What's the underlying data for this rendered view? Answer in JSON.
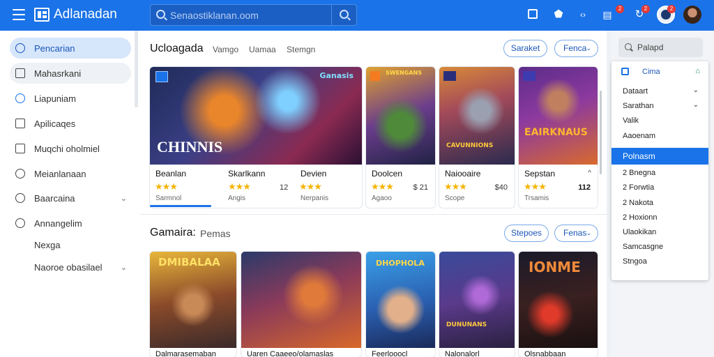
{
  "header": {
    "app_title": "Adlanadan",
    "search_placeholder": "Senaostiklanan.oom",
    "notifications_badge": "2",
    "messages_badge": "2",
    "alerts_badge": "2"
  },
  "sidebar": {
    "items": [
      {
        "label": "Pencarian",
        "icon": "search-icon"
      },
      {
        "label": "Mahasrkani",
        "icon": "book-icon"
      },
      {
        "label": "Liapuniam",
        "icon": "clock-icon"
      },
      {
        "label": "Apilicaqes",
        "icon": "bag-icon"
      },
      {
        "label": "Muqchi oholmiel",
        "icon": "monitor-icon"
      },
      {
        "label": "Meianlanaan",
        "icon": "chat-icon"
      },
      {
        "label": "Baarcaina",
        "icon": "circle-icon"
      },
      {
        "label": "Annangelim",
        "icon": "circle-icon"
      },
      {
        "label": "Nexga"
      },
      {
        "label": "Naoroe obasilael"
      }
    ]
  },
  "section1": {
    "title": "Ucloagada",
    "tabs": [
      "Vamgo",
      "Uamaa",
      "Stemgn"
    ],
    "buttons": [
      "Saraket",
      "Fenca"
    ],
    "cards": [
      {
        "title": "Beanlan",
        "rating": "★★★",
        "sub": "Sarmnol",
        "art_text": "CHINNIS",
        "badge": "Ganasis"
      },
      {
        "title": "Skarlkann",
        "rating": "★★★",
        "price": "12",
        "sub": "Angis",
        "art_text": "",
        "badge": ""
      },
      {
        "title": "Devien",
        "rating": "★★★",
        "sub": "Nerpanis",
        "art_text": "",
        "badge": ""
      },
      {
        "title": "Doolcen",
        "rating": "★★★",
        "price": "$ 21",
        "sub": "Agaoo",
        "art_text": "",
        "badge": "SWENGANS"
      },
      {
        "title": "Naiooaire",
        "rating": "★★★",
        "price": "$40",
        "sub": "Scope",
        "art_text": "CAVUNNIONS",
        "badge": ""
      },
      {
        "title": "Sepstan",
        "rating": "★★★",
        "price": "112",
        "sub": "Trsamis",
        "art_text": "EAIRKNAUS",
        "badge": ""
      }
    ]
  },
  "section2": {
    "title": "Gamaira:",
    "subtitle": "Pemas",
    "buttons": [
      "Stepoes",
      "Fenas"
    ],
    "cards": [
      {
        "title": "Dalmarasemaban",
        "art_text": "DMIBALAA"
      },
      {
        "title": "Uaren Caaeeo/olamaslas",
        "art_text": ""
      },
      {
        "title": "Feerlooocl",
        "art_text": "DHOPHOLA"
      },
      {
        "title": "Nalonalorl",
        "art_text": "DUNUNANS"
      },
      {
        "title": "Olsnabbaan",
        "art_text": "IONME"
      }
    ]
  },
  "right_panel": {
    "search_placeholder": "Palapd",
    "dropdown_header": "Cima",
    "items": [
      "Dataart",
      "Sarathan",
      "Valik",
      "Aaoenam"
    ],
    "selected": "Polnasm",
    "list": [
      "2 Bnegna",
      "2 Forwtia",
      "2 Nakota",
      "2 Hoxionn",
      "Ulaokikan",
      "Samcasgne",
      "Stngoa"
    ]
  }
}
